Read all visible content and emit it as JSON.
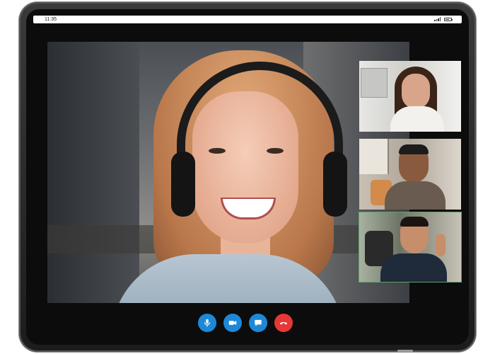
{
  "status_bar": {
    "time": "11:35",
    "signal_icon": "signal-icon",
    "battery_icon": "battery-icon"
  },
  "call": {
    "main_participant": "main-video-tile",
    "participants": [
      {
        "icon": "participant-video"
      },
      {
        "icon": "participant-video"
      },
      {
        "icon": "participant-video"
      }
    ]
  },
  "controls": [
    {
      "name": "microphone-button",
      "icon": "microphone-icon",
      "color": "#1e88d8"
    },
    {
      "name": "camera-button",
      "icon": "video-camera-icon",
      "color": "#1e88d8"
    },
    {
      "name": "chat-button",
      "icon": "chat-bubble-icon",
      "color": "#1e88d8"
    },
    {
      "name": "end-call-button",
      "icon": "phone-hangup-icon",
      "color": "#e53935"
    }
  ],
  "colors": {
    "accent": "#1e88d8",
    "danger": "#e53935",
    "device_frame": "#1c1c1e"
  }
}
